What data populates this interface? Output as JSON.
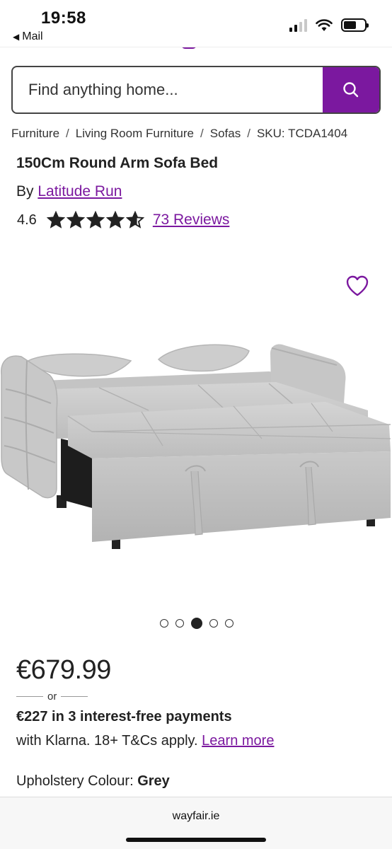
{
  "status_bar": {
    "time": "19:58",
    "back_label": "Mail",
    "back_arrow": "◀"
  },
  "search": {
    "placeholder": "Find anything home...",
    "button_icon": "search-icon"
  },
  "breadcrumb": {
    "items": [
      "Furniture",
      "Living Room Furniture",
      "Sofas",
      "SKU: TCDA1404"
    ],
    "separator": "/"
  },
  "product": {
    "title": "150Cm Round Arm Sofa Bed",
    "by_prefix": "By ",
    "brand": "Latitude Run",
    "rating_value": "4.6",
    "rating_stars": 4.6,
    "reviews_label": "73 Reviews",
    "price": "€679.99",
    "or_label": "or",
    "klarna_line1": "€227 in 3 interest-free payments",
    "klarna_line2": "with Klarna. 18+ T&Cs apply. ",
    "learn_more": "Learn more",
    "colour_label": "Upholstery Colour: ",
    "colour_value": "Grey"
  },
  "gallery": {
    "total": 5,
    "active_index": 2
  },
  "browser": {
    "url": "wayfair.ie"
  },
  "colors": {
    "brand_purple": "#7b189f",
    "text": "#222222"
  }
}
